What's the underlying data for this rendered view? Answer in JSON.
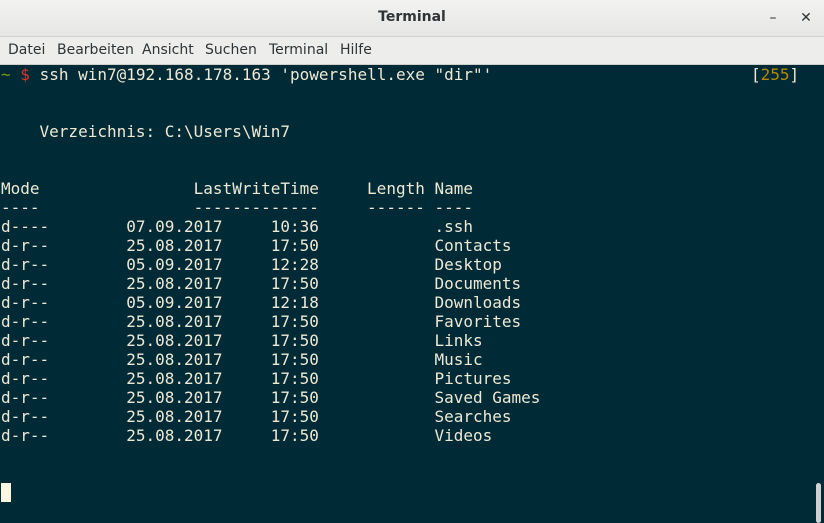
{
  "window": {
    "title": "Terminal",
    "minimize": "–",
    "close": "✕"
  },
  "menu": [
    "Datei",
    "Bearbeiten",
    "Ansicht",
    "Suchen",
    "Terminal",
    "Hilfe"
  ],
  "prompt": {
    "tilde": "~",
    "dollar": "$",
    "command": "ssh win7@192.168.178.163 'powershell.exe \"dir\"'",
    "bracket_open": "[",
    "exit_code": "255",
    "bracket_close": "]"
  },
  "directory_line": "    Verzeichnis: C:\\Users\\Win7",
  "header_line": "Mode                LastWriteTime     Length Name",
  "separator_line": "----                -------------     ------ ----",
  "rows": [
    "d----        07.09.2017     10:36            .ssh",
    "d-r--        25.08.2017     17:50            Contacts",
    "d-r--        05.09.2017     12:28            Desktop",
    "d-r--        25.08.2017     17:50            Documents",
    "d-r--        05.09.2017     12:18            Downloads",
    "d-r--        25.08.2017     17:50            Favorites",
    "d-r--        25.08.2017     17:50            Links",
    "d-r--        25.08.2017     17:50            Music",
    "d-r--        25.08.2017     17:50            Pictures",
    "d-r--        25.08.2017     17:50            Saved Games",
    "d-r--        25.08.2017     17:50            Searches",
    "d-r--        25.08.2017     17:50            Videos"
  ]
}
